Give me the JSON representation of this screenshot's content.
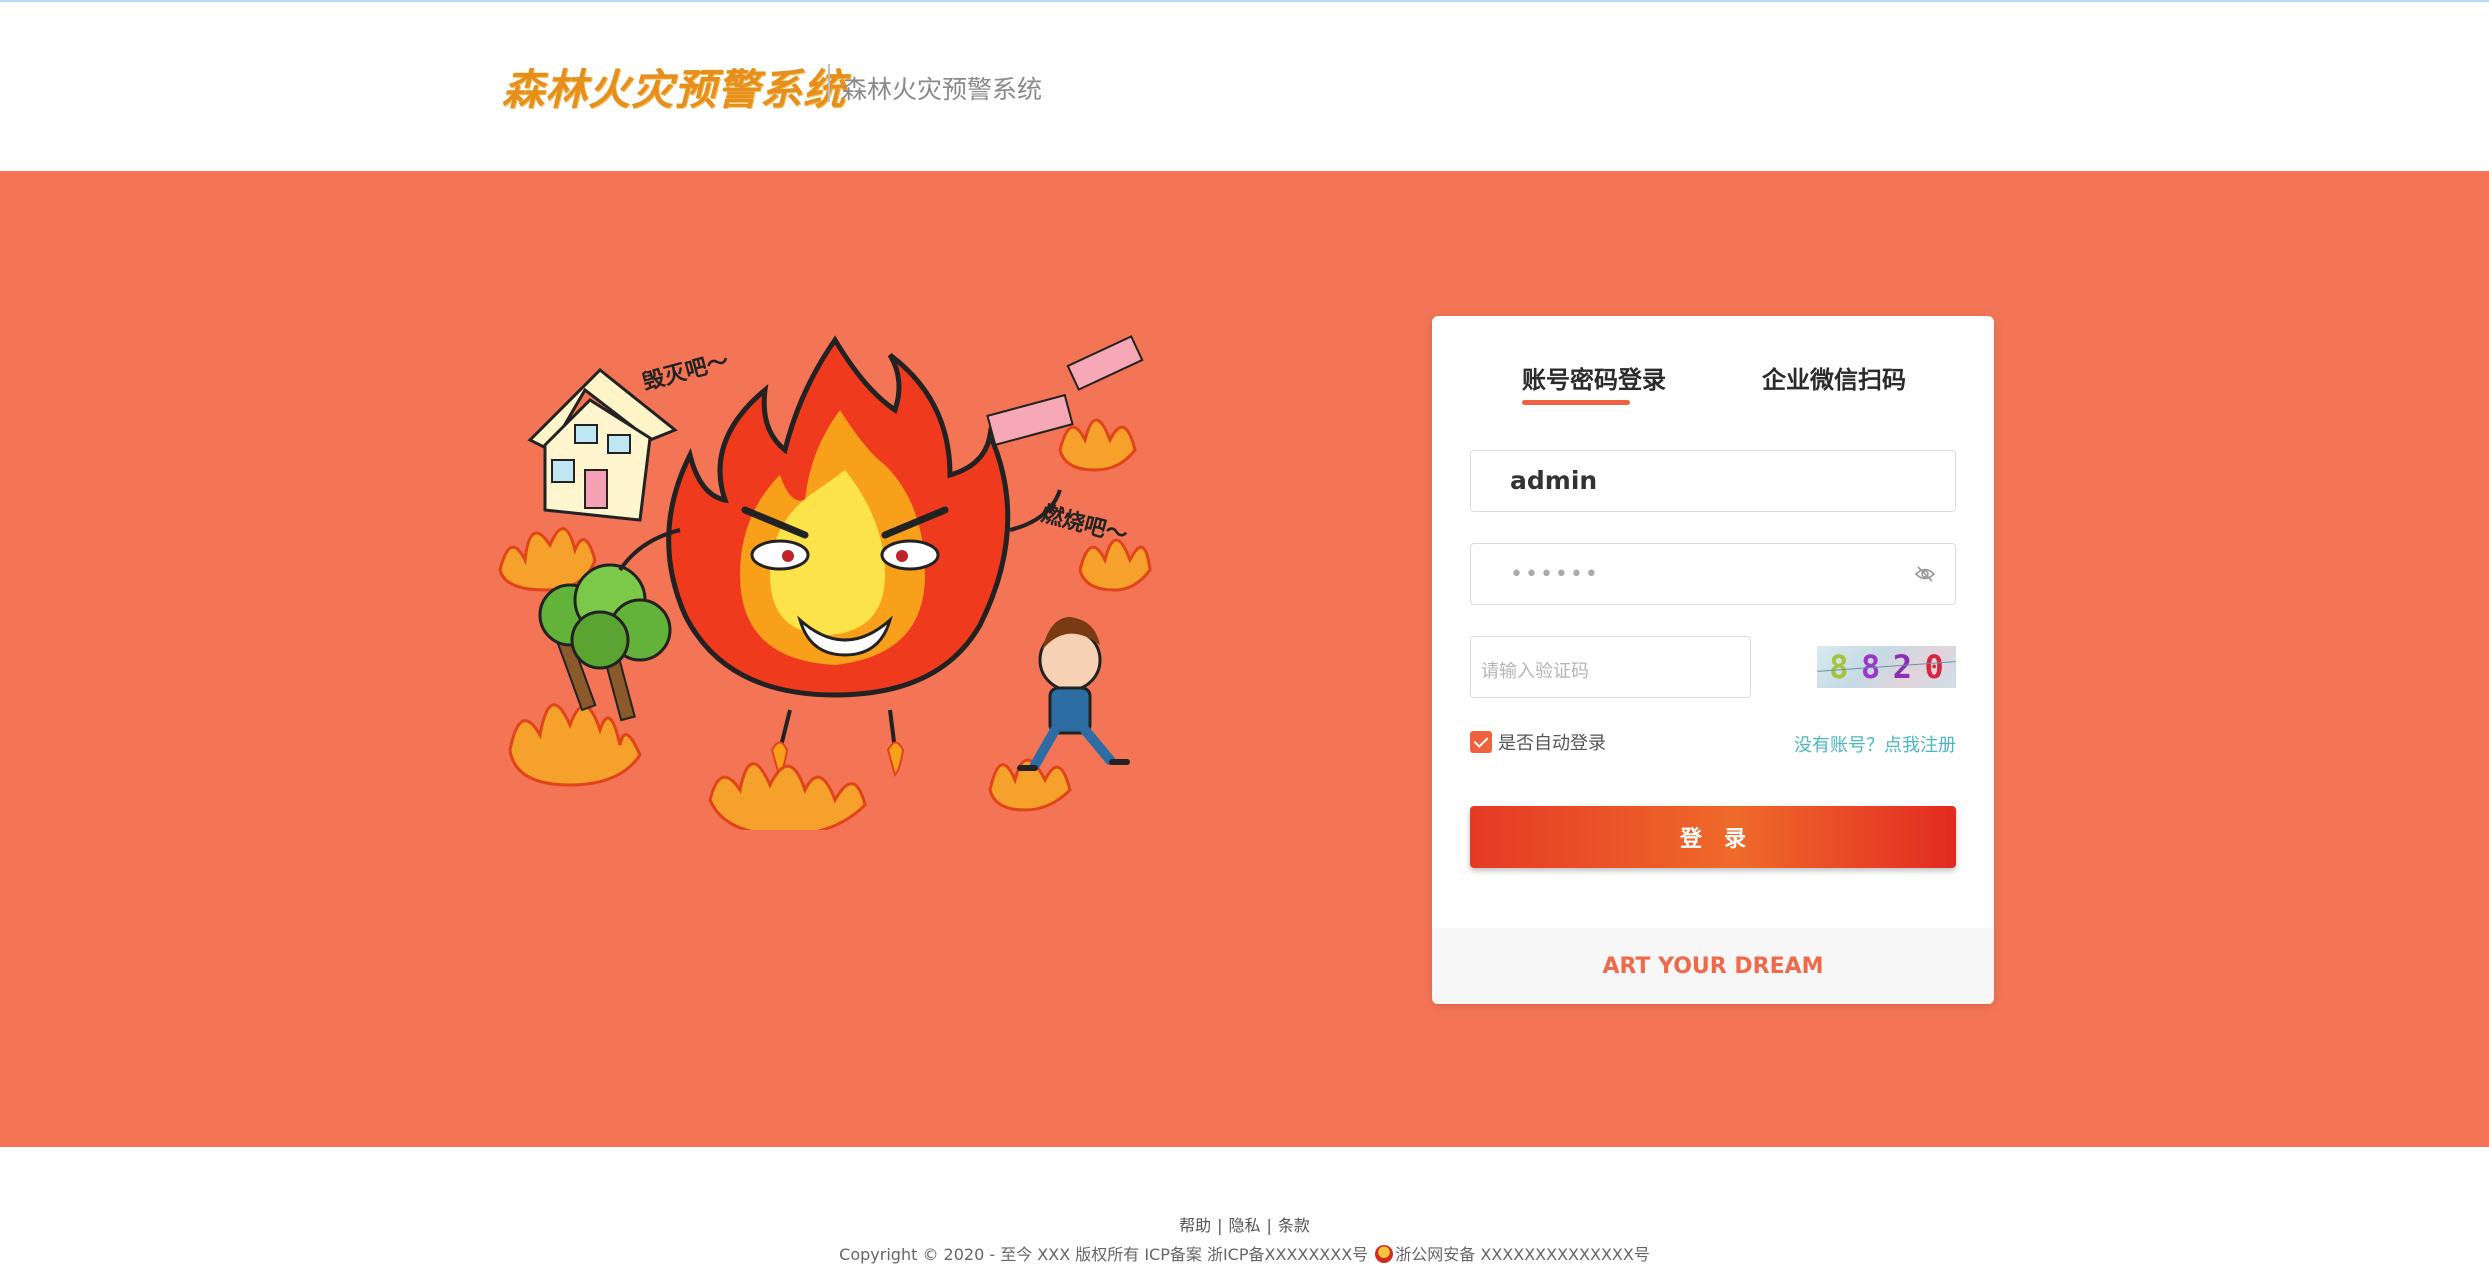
{
  "header": {
    "logo_text": "森林火灾预警系统",
    "subtitle": "森林火灾预警系统"
  },
  "illustration": {
    "caption_top": "毁灭吧～",
    "caption_right": "燃烧吧～"
  },
  "login": {
    "tabs": [
      {
        "label": "账号密码登录",
        "active": true
      },
      {
        "label": "企业微信扫码",
        "active": false
      }
    ],
    "username_value": "admin",
    "password_mask": "••••••",
    "captcha_placeholder": "请输入验证码",
    "captcha_chars": [
      "8",
      "8",
      "2",
      "0"
    ],
    "captcha_colors": [
      "#a5c33b",
      "#9b36c7",
      "#8b2fb6",
      "#d4283f"
    ],
    "remember_label": "是否自动登录",
    "remember_checked": true,
    "register_link": "没有账号？点我注册",
    "submit_label": "登录",
    "footer_slogan": "ART YOUR DREAM"
  },
  "footer": {
    "links": [
      "帮助",
      "隐私",
      "条款"
    ],
    "copyright_prefix": "Copyright © 2020 - 至今 XXX 版权所有 ICP备案 浙ICP备XXXXXXXX号",
    "police_text": "浙公网安备 XXXXXXXXXXXXXX号"
  },
  "colors": {
    "brand": "#f37556",
    "accent": "#f0613f",
    "link": "#4ab7c2"
  }
}
